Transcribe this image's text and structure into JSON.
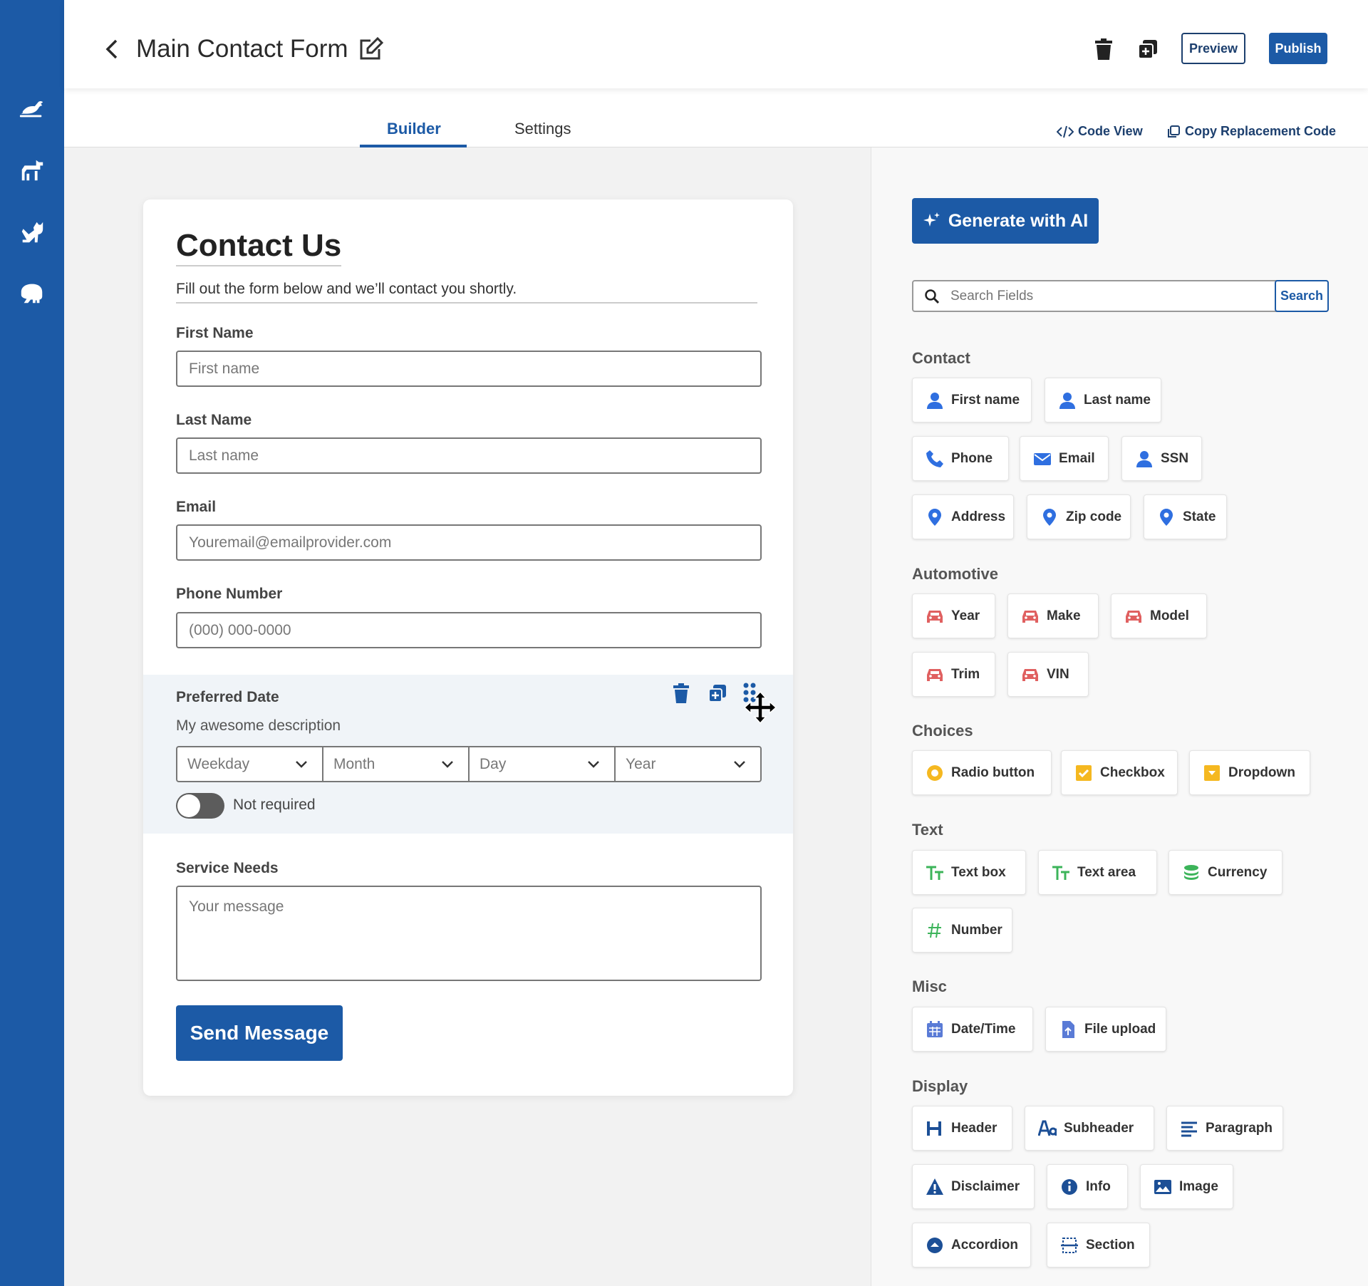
{
  "sidebar": {
    "icons": [
      "bird-icon",
      "dog-icon",
      "cat-icon",
      "elephant-icon"
    ]
  },
  "header": {
    "title": "Main Contact Form",
    "preview_label": "Preview",
    "publish_label": "Publish"
  },
  "tabs": {
    "builder": "Builder",
    "settings": "Settings",
    "code_view": "Code View",
    "copy_code": "Copy Replacement Code"
  },
  "form": {
    "title": "Contact Us",
    "subtitle": "Fill out the form below and we’ll contact you shortly.",
    "first_name": {
      "label": "First Name",
      "placeholder": "First name"
    },
    "last_name": {
      "label": "Last Name",
      "placeholder": "Last name"
    },
    "email": {
      "label": "Email",
      "placeholder": "Youremail@emailprovider.com"
    },
    "phone": {
      "label": "Phone Number",
      "placeholder": "(000) 000-0000"
    },
    "preferred_date": {
      "label": "Preferred Date",
      "description": "My awesome description",
      "selects": [
        "Weekday",
        "Month",
        "Day",
        "Year"
      ],
      "toggle_label": "Not required"
    },
    "service_needs": {
      "label": "Service Needs",
      "placeholder": "Your message"
    },
    "submit_label": "Send Message"
  },
  "panel": {
    "generate_label": "Generate with AI",
    "search_placeholder": "Search Fields",
    "search_button": "Search",
    "categories": {
      "contact": {
        "title": "Contact",
        "items": [
          "First name",
          "Last name",
          "Phone",
          "Email",
          "SSN",
          "Address",
          "Zip code",
          "State"
        ]
      },
      "automotive": {
        "title": "Automotive",
        "items": [
          "Year",
          "Make",
          "Model",
          "Trim",
          "VIN"
        ]
      },
      "choices": {
        "title": "Choices",
        "items": [
          "Radio button",
          "Checkbox",
          "Dropdown"
        ]
      },
      "text": {
        "title": "Text",
        "items": [
          "Text box",
          "Text area",
          "Currency",
          "Number"
        ]
      },
      "misc": {
        "title": "Misc",
        "items": [
          "Date/Time",
          "File upload"
        ]
      },
      "display": {
        "title": "Display",
        "items": [
          "Header",
          "Subheader",
          "Paragraph",
          "Disclaimer",
          "Info",
          "Image",
          "Accordion",
          "Section"
        ]
      }
    }
  },
  "colors": {
    "brand": "#1c5aa6",
    "contact_icon": "#2f6fe0",
    "automotive_icon": "#e06060",
    "choice_icon": "#f5b820",
    "text_icon": "#3cb45a",
    "display_icon": "#1c4f96"
  }
}
